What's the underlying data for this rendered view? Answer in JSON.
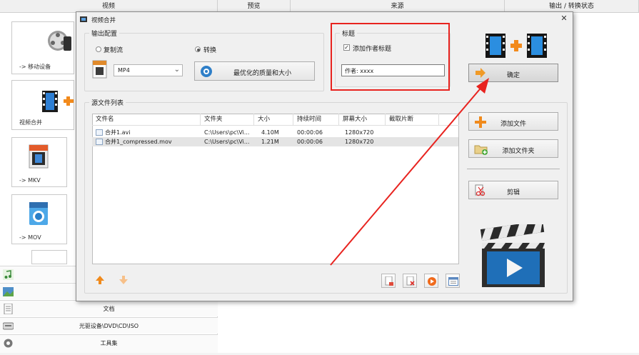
{
  "bg": {
    "tabs": [
      "视频",
      "预览",
      "来源",
      "输出 / 转换状态"
    ],
    "tiles": [
      "-> 移动设备",
      "视频合并",
      "-> MKV",
      "-> MOV"
    ],
    "categories": [
      "文档",
      "光驱设备\\DVD\\CD\\ISO",
      "工具集"
    ]
  },
  "dialog": {
    "title": "视频合并",
    "output_group": "输出配置",
    "radio_copy": "复制流",
    "radio_convert": "转换",
    "format_value": "MP4",
    "quality_button": "最优化的质量和大小",
    "title_group": "标题",
    "add_author_checkbox": "添加作者标题",
    "author_input": "作者: xxxx",
    "ok_button": "确定",
    "source_group": "源文件列表",
    "columns": [
      "文件名",
      "文件夹",
      "大小",
      "持续时间",
      "屏幕大小",
      "截取片断"
    ],
    "files": [
      {
        "name": "合并1.avi",
        "folder": "C:\\Users\\pc\\Vi...",
        "size": "4.10M",
        "duration": "00:00:06",
        "screen": "1280x720",
        "clip": ""
      },
      {
        "name": "合并1_compressed.mov",
        "folder": "C:\\Users\\pc\\Vi...",
        "size": "1.21M",
        "duration": "00:00:06",
        "screen": "1280x720",
        "clip": ""
      }
    ],
    "add_file_button": "添加文件",
    "add_folder_button": "添加文件夹",
    "edit_button": "剪辑"
  },
  "colors": {
    "annotation_red": "#e8231f",
    "selected_row": "#e4e4e4",
    "accent_blue": "#1f7ad0"
  }
}
